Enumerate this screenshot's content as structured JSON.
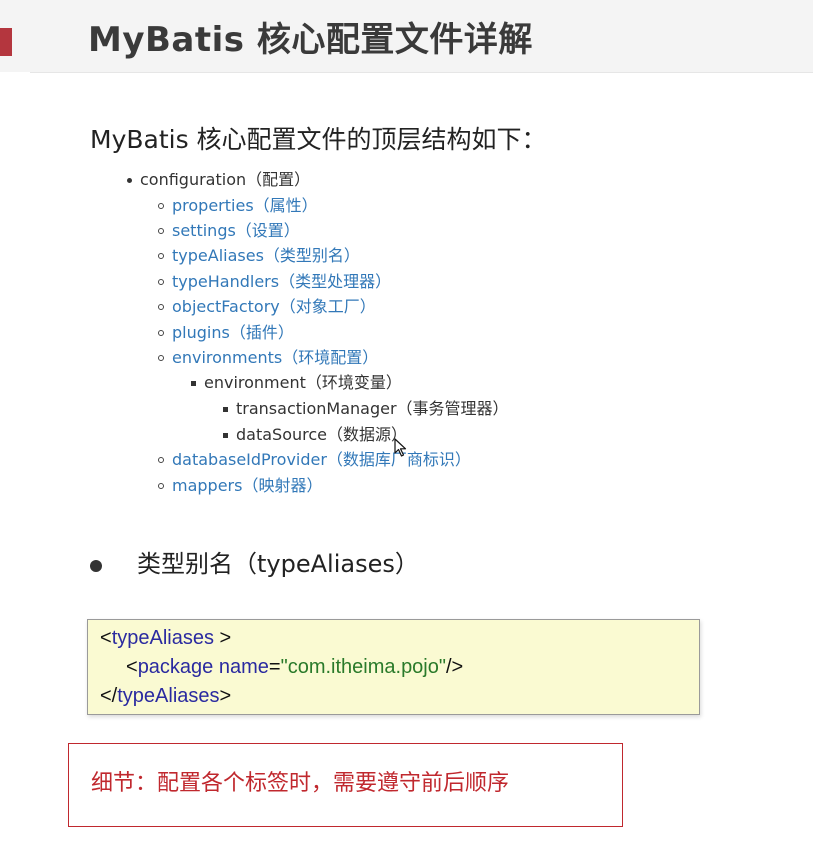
{
  "header": {
    "title": "MyBatis 核心配置文件详解",
    "accent_color": "#b4363e"
  },
  "section": {
    "heading": "MyBatis 核心配置文件的顶层结构如下："
  },
  "tree": {
    "root": "configuration（配置）",
    "children": [
      "properties（属性）",
      "settings（设置）",
      "typeAliases（类型别名）",
      "typeHandlers（类型处理器）",
      "objectFactory（对象工厂）",
      "plugins（插件）",
      "environments（环境配置）"
    ],
    "environment": "environment（环境变量）",
    "env_children": [
      "transactionManager（事务管理器）",
      "dataSource（数据源）"
    ],
    "after": [
      "databaseIdProvider（数据库厂商标识）",
      "mappers（映射器）"
    ],
    "link_color": "#3278b8"
  },
  "type_aliases": {
    "label": "类型别名（typeAliases）"
  },
  "code": {
    "line1_open": "<",
    "line1_tag": "typeAliases",
    "line1_close": " >",
    "line2_open": "<",
    "line2_tag": "package",
    "line2_attr": " name",
    "line2_eq": "=",
    "line2_val": "\"com.itheima.pojo\"",
    "line2_close": "/>",
    "line3_open": "</",
    "line3_tag": "typeAliases",
    "line3_close": ">",
    "background": "#fafad2"
  },
  "note": {
    "text": "细节：配置各个标签时，需要遵守前后顺序",
    "color": "#c0282e"
  },
  "icons": {
    "cursor": "mouse-pointer-icon"
  }
}
